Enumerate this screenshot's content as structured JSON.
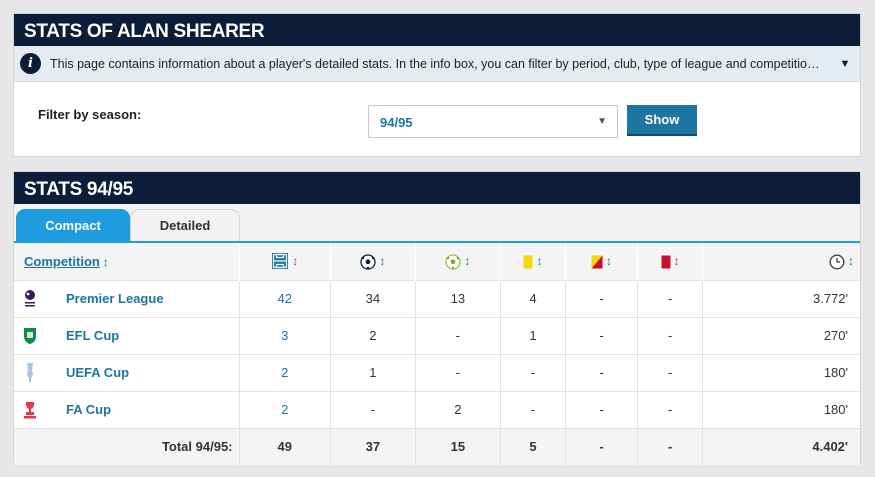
{
  "header": {
    "title": "STATS OF ALAN SHEARER"
  },
  "info": {
    "icon": "info-icon",
    "text": "This page contains information about a player's detailed stats. In the info box, you can filter by period, club, type of league and competition. Th...",
    "toggle": "▼"
  },
  "filter": {
    "label": "Filter by season:",
    "selected": "94/95",
    "arrow": "▼",
    "button": "Show"
  },
  "stats": {
    "title": "STATS 94/95",
    "tabs": [
      "Compact",
      "Detailed"
    ],
    "active_tab": "Compact",
    "columns": {
      "competition": "Competition",
      "appearances_icon": "appearances-icon",
      "goals_icon": "goals-icon",
      "assists_icon": "assists-icon",
      "yellow_icon": "yellow-card-icon",
      "second_yellow_icon": "second-yellow-icon",
      "red_icon": "red-card-icon",
      "minutes_icon": "clock-icon",
      "sort": "↕"
    },
    "rows": [
      {
        "logo": "premier-league-logo",
        "name": "Premier League",
        "apps": "42",
        "goals": "34",
        "assists": "13",
        "yellow": "4",
        "second_yellow": "-",
        "red": "-",
        "minutes": "3.772'"
      },
      {
        "logo": "efl-cup-logo",
        "name": "EFL Cup",
        "apps": "3",
        "goals": "2",
        "assists": "-",
        "yellow": "1",
        "second_yellow": "-",
        "red": "-",
        "minutes": "270'"
      },
      {
        "logo": "uefa-cup-logo",
        "name": "UEFA Cup",
        "apps": "2",
        "goals": "1",
        "assists": "-",
        "yellow": "-",
        "second_yellow": "-",
        "red": "-",
        "minutes": "180'"
      },
      {
        "logo": "fa-cup-logo",
        "name": "FA Cup",
        "apps": "2",
        "goals": "-",
        "assists": "2",
        "yellow": "-",
        "second_yellow": "-",
        "red": "-",
        "minutes": "180'"
      }
    ],
    "total": {
      "label": "Total 94/95:",
      "apps": "49",
      "goals": "37",
      "assists": "15",
      "yellow": "5",
      "second_yellow": "-",
      "red": "-",
      "minutes": "4.402'"
    }
  },
  "colors": {
    "header_bg": "#0c1d39",
    "accent": "#1f9be0",
    "link": "#1d75a3",
    "yellow_card": "#f5d800",
    "red_card": "#c8102e"
  }
}
